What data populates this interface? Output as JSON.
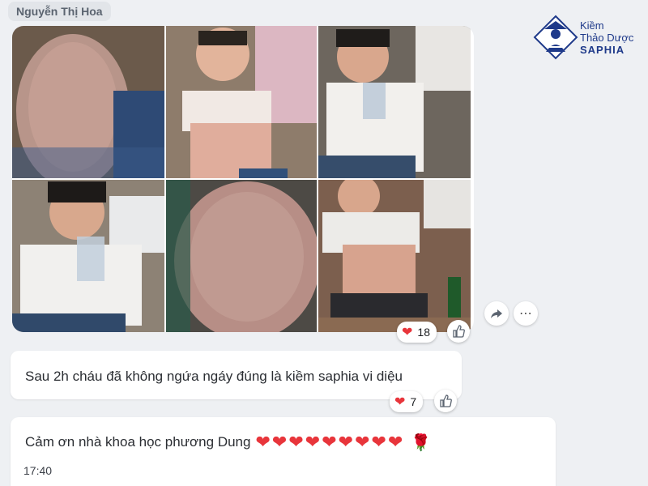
{
  "sender": {
    "name": "Nguyễn Thị Hoa"
  },
  "brand": {
    "line1": "Kiềm",
    "line2": "Thảo Dược",
    "line3": "SAPHIA",
    "logo_icon": "scholar-portrait-logo-icon"
  },
  "photos": [
    {
      "alt": "child back with rash"
    },
    {
      "alt": "child lifting shirt showing belly rash"
    },
    {
      "alt": "child drinking from glass"
    },
    {
      "alt": "child drinking from glass close-up"
    },
    {
      "alt": "back skin close-up"
    },
    {
      "alt": "smiling child lifting shirt next to bottle"
    }
  ],
  "photo_message": {
    "reaction_icon": "heart-icon",
    "reaction_count": "18",
    "like_icon": "thumbs-up-icon",
    "share_icon": "share-icon",
    "more_icon": "more-icon"
  },
  "message1": {
    "text": "Sau 2h cháu đã không ngứa ngáy  đúng là kiềm saphia vi diệu",
    "reaction_count": "7"
  },
  "message2": {
    "text": "Cảm ơn nhà khoa học phương Dung",
    "hearts": "❤❤❤❤❤❤❤❤❤",
    "rose": "🌹",
    "time": "17:40"
  },
  "colors": {
    "background": "#eef0f3",
    "heart": "#e8353b",
    "brand": "#1f3a8a"
  }
}
